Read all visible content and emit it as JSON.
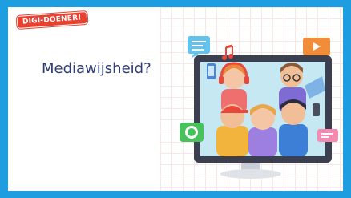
{
  "logo": {
    "text": "DIGI-DOENER!"
  },
  "slide": {
    "title": "Mediawijsheid?"
  },
  "illustration": {
    "icons": [
      "chat-bubble-icon",
      "music-note-icon",
      "video-play-icon",
      "phone-icon",
      "message-icon",
      "laptop-icon"
    ],
    "colors": {
      "background": "#1e9de0",
      "monitor": "#3b3f4f",
      "screen": "#c6e8f2",
      "phone_bubble": "#47c25c",
      "video_icon": "#f08c3a",
      "chat_bubble": "#63c3ee",
      "message_bubble": "#f58ab0"
    }
  }
}
